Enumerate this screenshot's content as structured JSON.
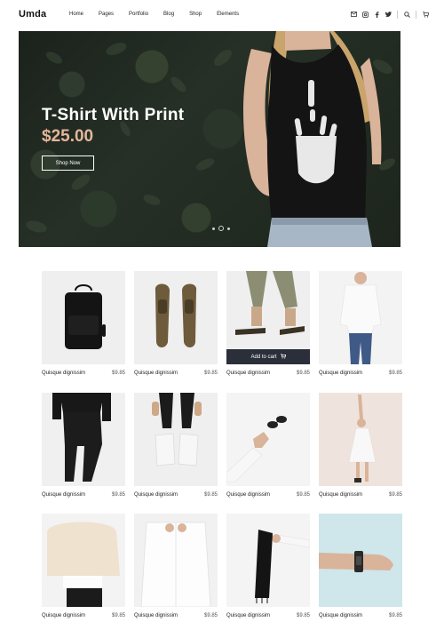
{
  "header": {
    "logo": "Umda",
    "nav": [
      "Home",
      "Pages",
      "Portfolio",
      "Blog",
      "Shop",
      "Elements"
    ],
    "icons": [
      "mail-icon",
      "instagram-icon",
      "facebook-icon",
      "twitter-icon",
      "search-icon",
      "cart-icon"
    ]
  },
  "hero": {
    "title": "T-Shirt With Print",
    "price": "$25.00",
    "button": "Shop Now",
    "slides": 3,
    "active_slide": 2
  },
  "products": {
    "add_to_cart": "Add to cart",
    "items": [
      {
        "name": "Quisque dignissim",
        "price": "$9.85",
        "image": "black-backpack"
      },
      {
        "name": "Quisque dignissim",
        "price": "$9.85",
        "image": "brown-shoes"
      },
      {
        "name": "Quisque dignissim",
        "price": "$9.85",
        "image": "sandals"
      },
      {
        "name": "Quisque dignissim",
        "price": "$9.85",
        "image": "white-sweater-jeans"
      },
      {
        "name": "Quisque dignissim",
        "price": "$9.85",
        "image": "black-outfit"
      },
      {
        "name": "Quisque dignissim",
        "price": "$9.85",
        "image": "white-sneakers"
      },
      {
        "name": "Quisque dignissim",
        "price": "$9.85",
        "image": "sunglasses-hand"
      },
      {
        "name": "Quisque dignissim",
        "price": "$9.85",
        "image": "white-dress"
      },
      {
        "name": "Quisque dignissim",
        "price": "$9.85",
        "image": "cream-sweater"
      },
      {
        "name": "Quisque dignissim",
        "price": "$9.85",
        "image": "white-shirt"
      },
      {
        "name": "Quisque dignissim",
        "price": "$9.85",
        "image": "black-scarf"
      },
      {
        "name": "Quisque dignissim",
        "price": "$9.85",
        "image": "wrist-watch"
      }
    ]
  },
  "colors": {
    "accent": "#e3b69a",
    "dark_button": "#2b2f3a",
    "hero_bg": "#1f281f"
  }
}
